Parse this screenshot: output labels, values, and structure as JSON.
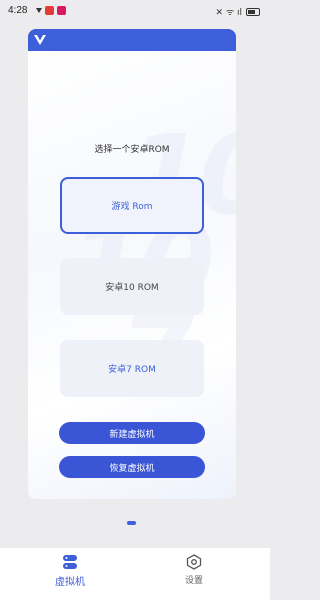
{
  "status_bar": {
    "time": "4:28",
    "right_text": "✕ ᯤ ıl"
  },
  "header": {
    "logo_icon": "v-logo-icon"
  },
  "main": {
    "title": "选择一个安卓ROM",
    "roms": [
      {
        "label": "游戏 Rom",
        "state": "selected"
      },
      {
        "label": "安卓10 ROM",
        "state": "normal"
      },
      {
        "label": "安卓7 ROM",
        "state": "normal"
      }
    ],
    "actions": {
      "new_vm": "新建虚拟机",
      "restore_vm": "恢复虚拟机"
    }
  },
  "bottom_nav": {
    "items": [
      {
        "label": "虚拟机",
        "icon": "database-icon",
        "active": true
      },
      {
        "label": "设置",
        "icon": "hexagon-settings-icon",
        "active": false
      }
    ]
  },
  "colors": {
    "accent": "#3d5fd9",
    "background": "#ececee"
  }
}
